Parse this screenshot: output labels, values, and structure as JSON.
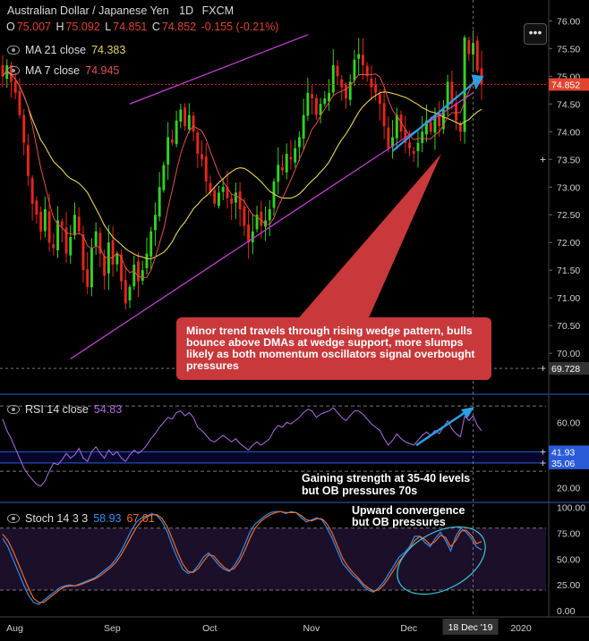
{
  "header": {
    "symbol": "Australian Dollar / Japanese Yen",
    "interval": "1D",
    "source": "FXCM",
    "o_label": "O",
    "o_val": "75.007",
    "h_label": "H",
    "h_val": "75.092",
    "l_label": "L",
    "l_val": "74.851",
    "c_label": "C",
    "c_val": "74.852",
    "change": "-0.155 (-0.21%)"
  },
  "indicators": {
    "ma21_label": "MA 21 close",
    "ma21_val": "74.383",
    "ma7_label": "MA 7 close",
    "ma7_val": "74.945",
    "rsi_label": "RSI 14 close",
    "rsi_val": "54.83",
    "stoch_label": "Stoch 14 3 3",
    "stoch_k": "58.93",
    "stoch_d": "67.01"
  },
  "annotations": {
    "callout": "Minor trend travels through rising wedge pattern, bulls bounce above DMAs at wedge support, more slumps likely as both momentum oscillators signal overbought pressures",
    "rsi_note_1": "Gaining strength at 35-40 levels",
    "rsi_note_2": "but OB pressures 70s",
    "stoch_note_1": "Upward convergence",
    "stoch_note_2": "but OB pressures"
  },
  "menu_label": "•••",
  "colors": {
    "bull": "#31d321",
    "bear": "#e8251b",
    "ma21": "#e8d25a",
    "ma7": "#e05050",
    "wedge": "#c03fd0",
    "arrow": "#2aa0e6",
    "rsi": "#b06ae0",
    "stoch_k": "#2f8ff0",
    "stoch_d": "#ee6c2a",
    "callout_bg": "#c9383a"
  },
  "chart_data": [
    {
      "type": "candlestick",
      "title": "Australian Dollar / Japanese Yen 1D FXCM",
      "x_tick_labels": [
        "Aug",
        "Sep",
        "Oct",
        "Nov",
        "Dec",
        "2020"
      ],
      "cursor_date": "18 Dec '19",
      "ylim": [
        69.6,
        76.15
      ],
      "y_ticks": [
        "76.00",
        "75.50",
        "75.00",
        "74.50",
        "74.00",
        "73.50",
        "73.00",
        "72.50",
        "72.00",
        "71.50",
        "71.00",
        "70.50",
        "70.00"
      ],
      "last_price": "74.852",
      "cursor_price": "69.728",
      "close": [
        75.0,
        75.2,
        74.9,
        74.7,
        74.3,
        73.8,
        73.2,
        72.7,
        72.5,
        72.2,
        72.6,
        72.0,
        71.9,
        72.4,
        72.3,
        71.8,
        72.1,
        72.5,
        72.2,
        71.5,
        71.2,
        71.9,
        72.2,
        71.8,
        71.4,
        72.0,
        71.6,
        71.8,
        71.3,
        70.9,
        71.2,
        71.6,
        71.3,
        71.5,
        71.8,
        72.2,
        72.5,
        73.0,
        73.4,
        73.9,
        73.8,
        74.2,
        74.4,
        74.1,
        74.3,
        74.0,
        73.6,
        73.5,
        73.1,
        72.9,
        72.7,
        72.9,
        73.0,
        72.8,
        72.7,
        72.9,
        72.6,
        72.3,
        72.0,
        72.2,
        72.5,
        72.3,
        72.4,
        72.6,
        73.1,
        73.4,
        73.3,
        73.6,
        73.5,
        73.7,
        73.9,
        74.3,
        74.7,
        74.6,
        74.3,
        74.5,
        74.6,
        74.7,
        75.2,
        75.0,
        74.8,
        74.6,
        74.9,
        75.3,
        75.4,
        75.2,
        75.0,
        74.8,
        74.7,
        74.5,
        74.1,
        73.7,
        73.9,
        74.3,
        74.0,
        73.8,
        73.7,
        73.6,
        73.8,
        74.0,
        74.2,
        74.0,
        74.3,
        74.1,
        74.4,
        74.9,
        74.5,
        74.2,
        74.0,
        75.7,
        75.4,
        75.6,
        75.1,
        74.85
      ],
      "series": [
        {
          "name": "MA 21 close",
          "last": 74.383
        },
        {
          "name": "MA 7 close",
          "last": 74.945
        }
      ],
      "annotations_lines": [
        "upper wedge line",
        "lower wedge line",
        "rising arrow"
      ]
    },
    {
      "type": "line",
      "title": "RSI 14 close",
      "ylim": [
        12,
        75
      ],
      "y_ticks": [
        "60.00",
        "20.00"
      ],
      "bands": [
        "41.93",
        "35.06"
      ],
      "values": [
        62,
        55,
        50,
        44,
        38,
        32,
        28,
        25,
        22,
        21,
        24,
        30,
        35,
        34,
        37,
        41,
        38,
        40,
        44,
        38,
        36,
        42,
        45,
        41,
        38,
        43,
        40,
        42,
        38,
        36,
        40,
        43,
        41,
        43,
        46,
        50,
        53,
        57,
        60,
        63,
        62,
        66,
        67,
        64,
        66,
        63,
        57,
        55,
        52,
        49,
        48,
        50,
        52,
        50,
        48,
        50,
        47,
        45,
        43,
        46,
        48,
        46,
        48,
        50,
        55,
        58,
        57,
        60,
        59,
        61,
        63,
        66,
        68,
        67,
        63,
        65,
        66,
        67,
        69,
        66,
        63,
        61,
        64,
        67,
        67,
        65,
        62,
        59,
        57,
        55,
        50,
        46,
        49,
        53,
        50,
        48,
        47,
        46,
        49,
        52,
        54,
        52,
        55,
        53,
        57,
        61,
        56,
        53,
        51,
        64,
        61,
        64,
        58,
        54.83
      ],
      "series": [
        {
          "name": "RSI 14 close",
          "last": 54.83
        }
      ]
    },
    {
      "type": "line",
      "title": "Stoch 14 3 3",
      "ylim": [
        0,
        100
      ],
      "y_ticks": [
        "100.00",
        "75.00",
        "50.00",
        "25.00",
        "0.00"
      ],
      "series": [
        {
          "name": "%K",
          "last": 58.93,
          "values": [
            70,
            62,
            50,
            38,
            26,
            15,
            8,
            6,
            10,
            14,
            18,
            22,
            24,
            25,
            24,
            26,
            28,
            30,
            32,
            36,
            40,
            44,
            50,
            58,
            68,
            78,
            86,
            90,
            92,
            94,
            92,
            86,
            76,
            62,
            50,
            40,
            36,
            38,
            44,
            52,
            56,
            50,
            44,
            40,
            38,
            44,
            52,
            64,
            76,
            84,
            88,
            92,
            95,
            96,
            96,
            94,
            96,
            95,
            90,
            86,
            88,
            90,
            88,
            80,
            70,
            58,
            46,
            40,
            34,
            30,
            24,
            20,
            18,
            22,
            28,
            36,
            44,
            52,
            56,
            62,
            72,
            72,
            66,
            62,
            70,
            76,
            68,
            58,
            72,
            80,
            76,
            70,
            62,
            58.93
          ]
        },
        {
          "name": "%D",
          "last": 67.01,
          "values": [
            74,
            68,
            58,
            46,
            34,
            22,
            12,
            8,
            8,
            12,
            16,
            20,
            23,
            24,
            24,
            25,
            27,
            29,
            31,
            34,
            38,
            42,
            47,
            54,
            63,
            72,
            81,
            87,
            91,
            93,
            93,
            89,
            81,
            69,
            56,
            45,
            38,
            37,
            41,
            48,
            54,
            53,
            47,
            42,
            39,
            41,
            48,
            58,
            70,
            80,
            86,
            90,
            93,
            95,
            96,
            95,
            95,
            95,
            92,
            88,
            87,
            89,
            89,
            84,
            75,
            63,
            51,
            43,
            37,
            32,
            26,
            22,
            19,
            20,
            25,
            32,
            40,
            48,
            54,
            60,
            68,
            72,
            69,
            64,
            67,
            73,
            71,
            62,
            68,
            77,
            78,
            73,
            65,
            67.01
          ]
        }
      ],
      "bands": [
        80,
        20
      ]
    }
  ]
}
